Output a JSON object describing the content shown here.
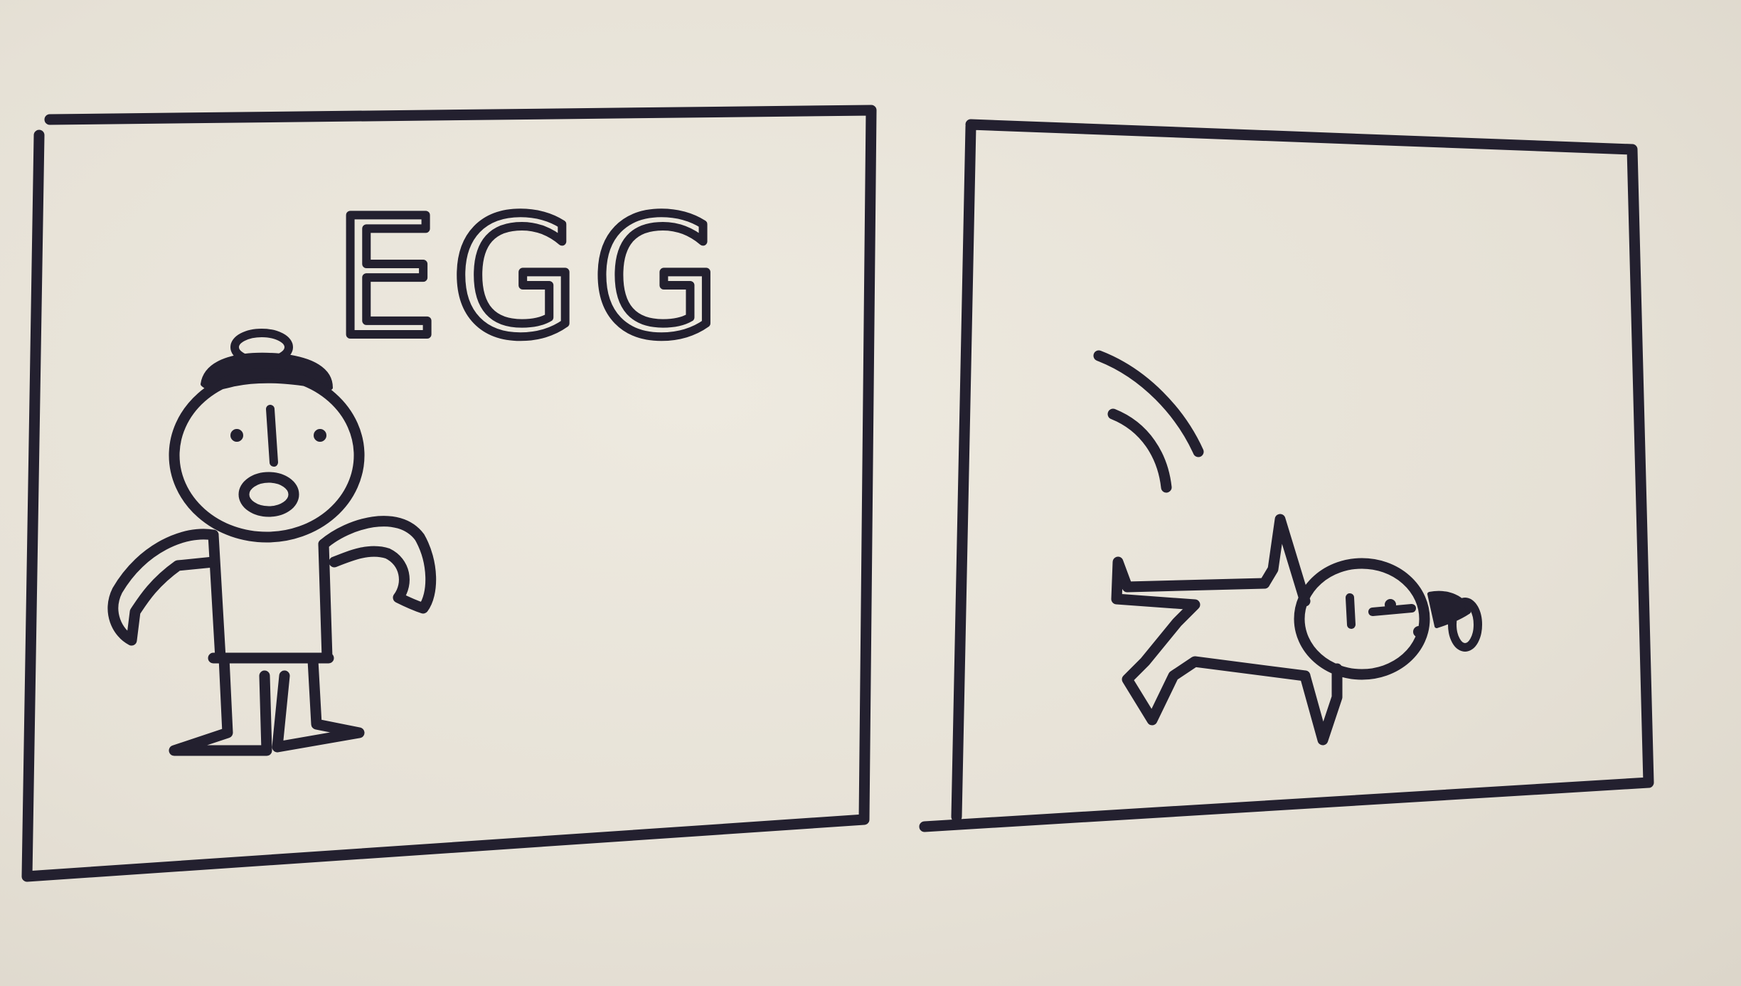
{
  "comic": {
    "panels": [
      {
        "id": "panel-1",
        "speech": "EGG"
      },
      {
        "id": "panel-2"
      }
    ]
  },
  "colors": {
    "paper": "#e9e4d9",
    "ink": "#23202f"
  }
}
